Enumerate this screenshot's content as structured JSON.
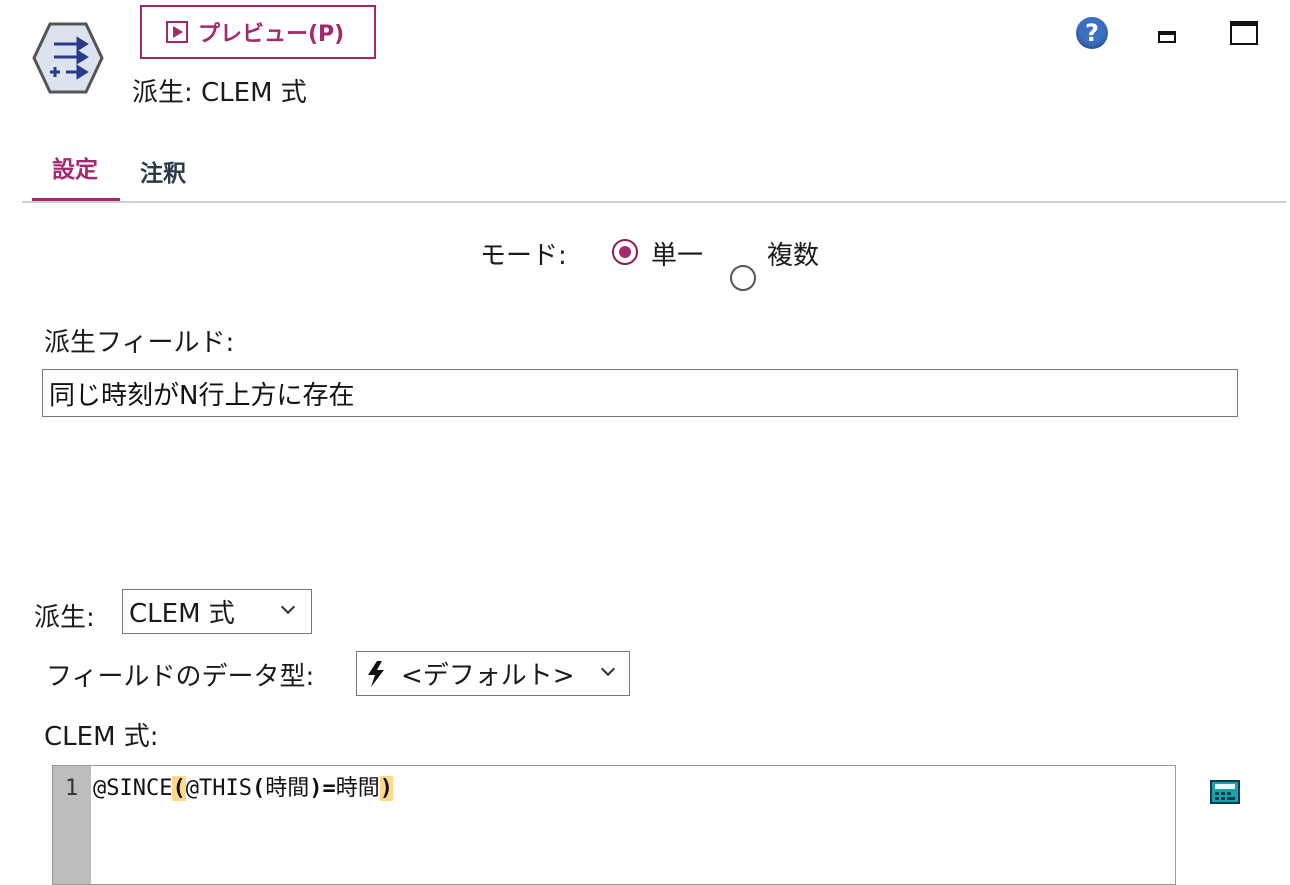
{
  "header": {
    "preview_label": "プレビュー(P)",
    "node_title": "派生: CLEM 式",
    "help_glyph": "?"
  },
  "tabs": [
    {
      "label": "設定",
      "active": true
    },
    {
      "label": "注釈",
      "active": false
    }
  ],
  "mode": {
    "label": "モード:",
    "options": [
      {
        "label": "単一",
        "selected": true
      },
      {
        "label": "複数",
        "selected": false
      }
    ]
  },
  "derived_field": {
    "label": "派生フィールド:",
    "value": "同じ時刻がN行上方に存在"
  },
  "derive": {
    "label": "派生:",
    "selected": "CLEM 式"
  },
  "field_type": {
    "label": "フィールドのデータ型:",
    "selected": "<デフォルト>"
  },
  "clem": {
    "label": "CLEM 式:",
    "line_number": "1",
    "tokens": [
      "@SINCE",
      "(",
      "@THIS",
      "(",
      "時間",
      ")",
      "=",
      "時間",
      ")"
    ]
  },
  "colors": {
    "accent": "#a3286e",
    "highlight": "#ffd98a",
    "gutter": "#bdbdbd"
  },
  "icons": [
    "derive-node-icon",
    "play-icon",
    "help-icon",
    "minimize-icon",
    "maximize-icon",
    "lightning-icon",
    "chevron-down-icon",
    "calculator-icon"
  ]
}
